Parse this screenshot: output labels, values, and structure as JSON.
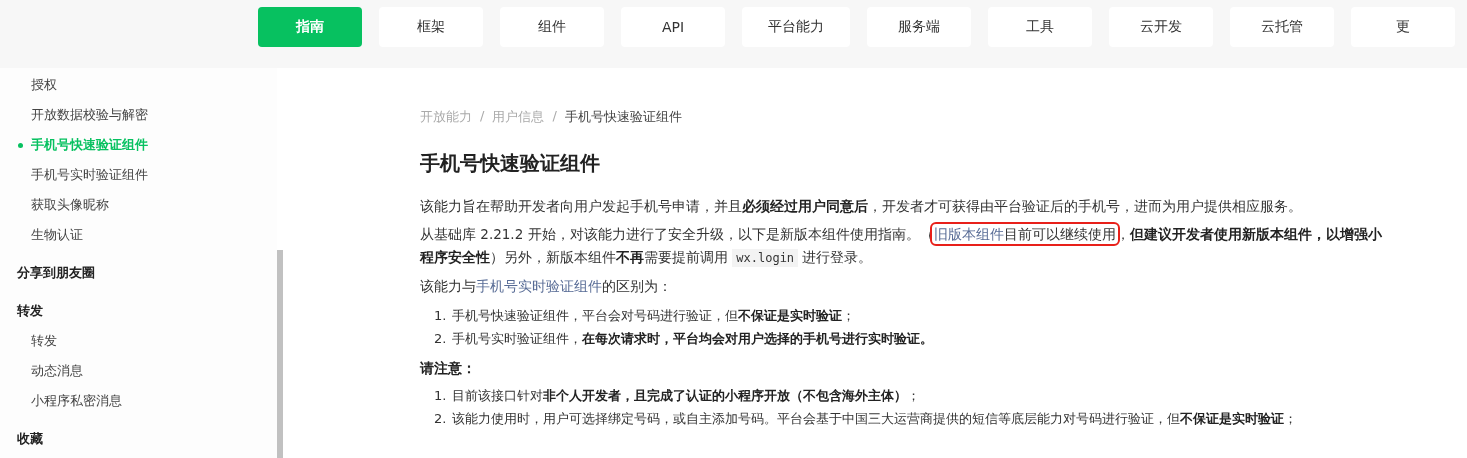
{
  "nav": {
    "tabs": [
      {
        "label": "指南",
        "selected": true
      },
      {
        "label": "框架",
        "selected": false
      },
      {
        "label": "组件",
        "selected": false
      },
      {
        "label": "API",
        "selected": false
      },
      {
        "label": "平台能力",
        "selected": false
      },
      {
        "label": "服务端",
        "selected": false
      },
      {
        "label": "工具",
        "selected": false
      },
      {
        "label": "云开发",
        "selected": false
      },
      {
        "label": "云托管",
        "selected": false
      },
      {
        "label": "更",
        "selected": false
      }
    ]
  },
  "sidebar": {
    "groups": [
      {
        "children": [
          {
            "label": "授权",
            "selected": false
          },
          {
            "label": "开放数据校验与解密",
            "selected": false
          },
          {
            "label": "手机号快速验证组件",
            "selected": true
          },
          {
            "label": "手机号实时验证组件",
            "selected": false
          },
          {
            "label": "获取头像昵称",
            "selected": false
          },
          {
            "label": "生物认证",
            "selected": false
          }
        ]
      },
      {
        "title": "分享到朋友圈"
      },
      {
        "title": "转发",
        "children": [
          {
            "label": "转发",
            "selected": false
          },
          {
            "label": "动态消息",
            "selected": false
          },
          {
            "label": "小程序私密消息",
            "selected": false
          }
        ]
      },
      {
        "title": "收藏"
      }
    ]
  },
  "breadcrumb": {
    "separator": "/",
    "items": [
      "开放能力",
      "用户信息",
      "手机号快速验证组件"
    ]
  },
  "title": "手机号快速验证组件",
  "blocks": [
    {
      "kind": "paragraph",
      "segments": [
        {
          "kind": "text",
          "text": "该能力旨在帮助开发者向用户发起手机号申请，并且"
        },
        {
          "kind": "bold",
          "text": "必须经过用户同意后"
        },
        {
          "kind": "text",
          "text": "，开发者才可获得由平台验证后的手机号，进而为用户提供相应服务。"
        }
      ]
    },
    {
      "kind": "paragraph",
      "segments": [
        {
          "kind": "text",
          "text": "从基础库 2.21.2 开始，对该能力进行了安全升级，以下是新版本组件使用指南。（"
        },
        {
          "kind": "boxed",
          "segments": [
            {
              "kind": "link",
              "text": "旧版本组件"
            },
            {
              "kind": "text",
              "text": "目前可以继续使用"
            }
          ]
        },
        {
          "kind": "text",
          "text": "，"
        },
        {
          "kind": "bold",
          "text": "但建议开发者使用新版本组件，以增强小程序安全性"
        },
        {
          "kind": "text",
          "text": "）另外，新版本组件"
        },
        {
          "kind": "bold",
          "text": "不再"
        },
        {
          "kind": "text",
          "text": "需要提前调用 "
        },
        {
          "kind": "code",
          "text": "wx.login"
        },
        {
          "kind": "text",
          "text": " 进行登录。"
        }
      ]
    },
    {
      "kind": "paragraph",
      "segments": [
        {
          "kind": "text",
          "text": "该能力与"
        },
        {
          "kind": "link",
          "text": "手机号实时验证组件"
        },
        {
          "kind": "text",
          "text": "的区别为："
        }
      ]
    },
    {
      "kind": "list",
      "items": [
        {
          "number": "1.",
          "segments": [
            {
              "kind": "text",
              "text": "手机号快速验证组件，平台会对号码进行验证，但"
            },
            {
              "kind": "bold",
              "text": "不保证是实时验证"
            },
            {
              "kind": "text",
              "text": "；"
            }
          ]
        },
        {
          "number": "2.",
          "segments": [
            {
              "kind": "text",
              "text": "手机号实时验证组件，"
            },
            {
              "kind": "bold",
              "text": "在每次请求时，平台均会对用户选择的手机号进行实时验证。"
            }
          ]
        }
      ]
    },
    {
      "kind": "heading",
      "text": "请注意："
    },
    {
      "kind": "list",
      "items": [
        {
          "number": "1.",
          "segments": [
            {
              "kind": "text",
              "text": "目前该接口针对"
            },
            {
              "kind": "bold",
              "text": "非个人开发者，且完成了认证的小程序开放（不包含海外主体）"
            },
            {
              "kind": "text",
              "text": "；"
            }
          ]
        },
        {
          "number": "2.",
          "segments": [
            {
              "kind": "text",
              "text": "该能力使用时，用户可选择绑定号码，或自主添加号码。平台会基于中国三大运营商提供的短信等底层能力对号码进行验证，但"
            },
            {
              "kind": "bold",
              "text": "不保证是实时验证"
            },
            {
              "kind": "text",
              "text": "；"
            }
          ]
        }
      ]
    }
  ]
}
